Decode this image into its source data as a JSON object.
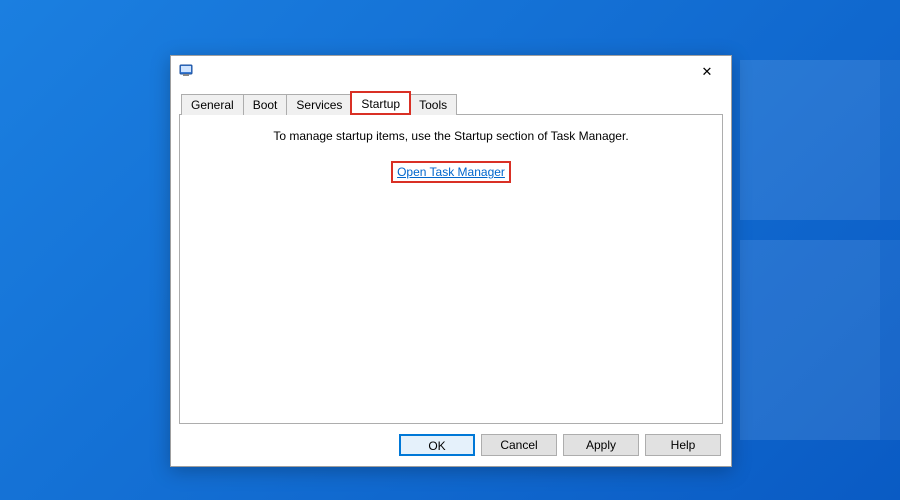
{
  "tabs": {
    "general": "General",
    "boot": "Boot",
    "services": "Services",
    "startup": "Startup",
    "tools": "Tools",
    "active": "startup"
  },
  "startup_tab": {
    "instruction": "To manage startup items, use the Startup section of Task Manager.",
    "link_label": "Open Task Manager"
  },
  "buttons": {
    "ok": "OK",
    "cancel": "Cancel",
    "apply": "Apply",
    "help": "Help"
  },
  "highlight": {
    "tab": true,
    "link": true,
    "color": "#d93025"
  }
}
